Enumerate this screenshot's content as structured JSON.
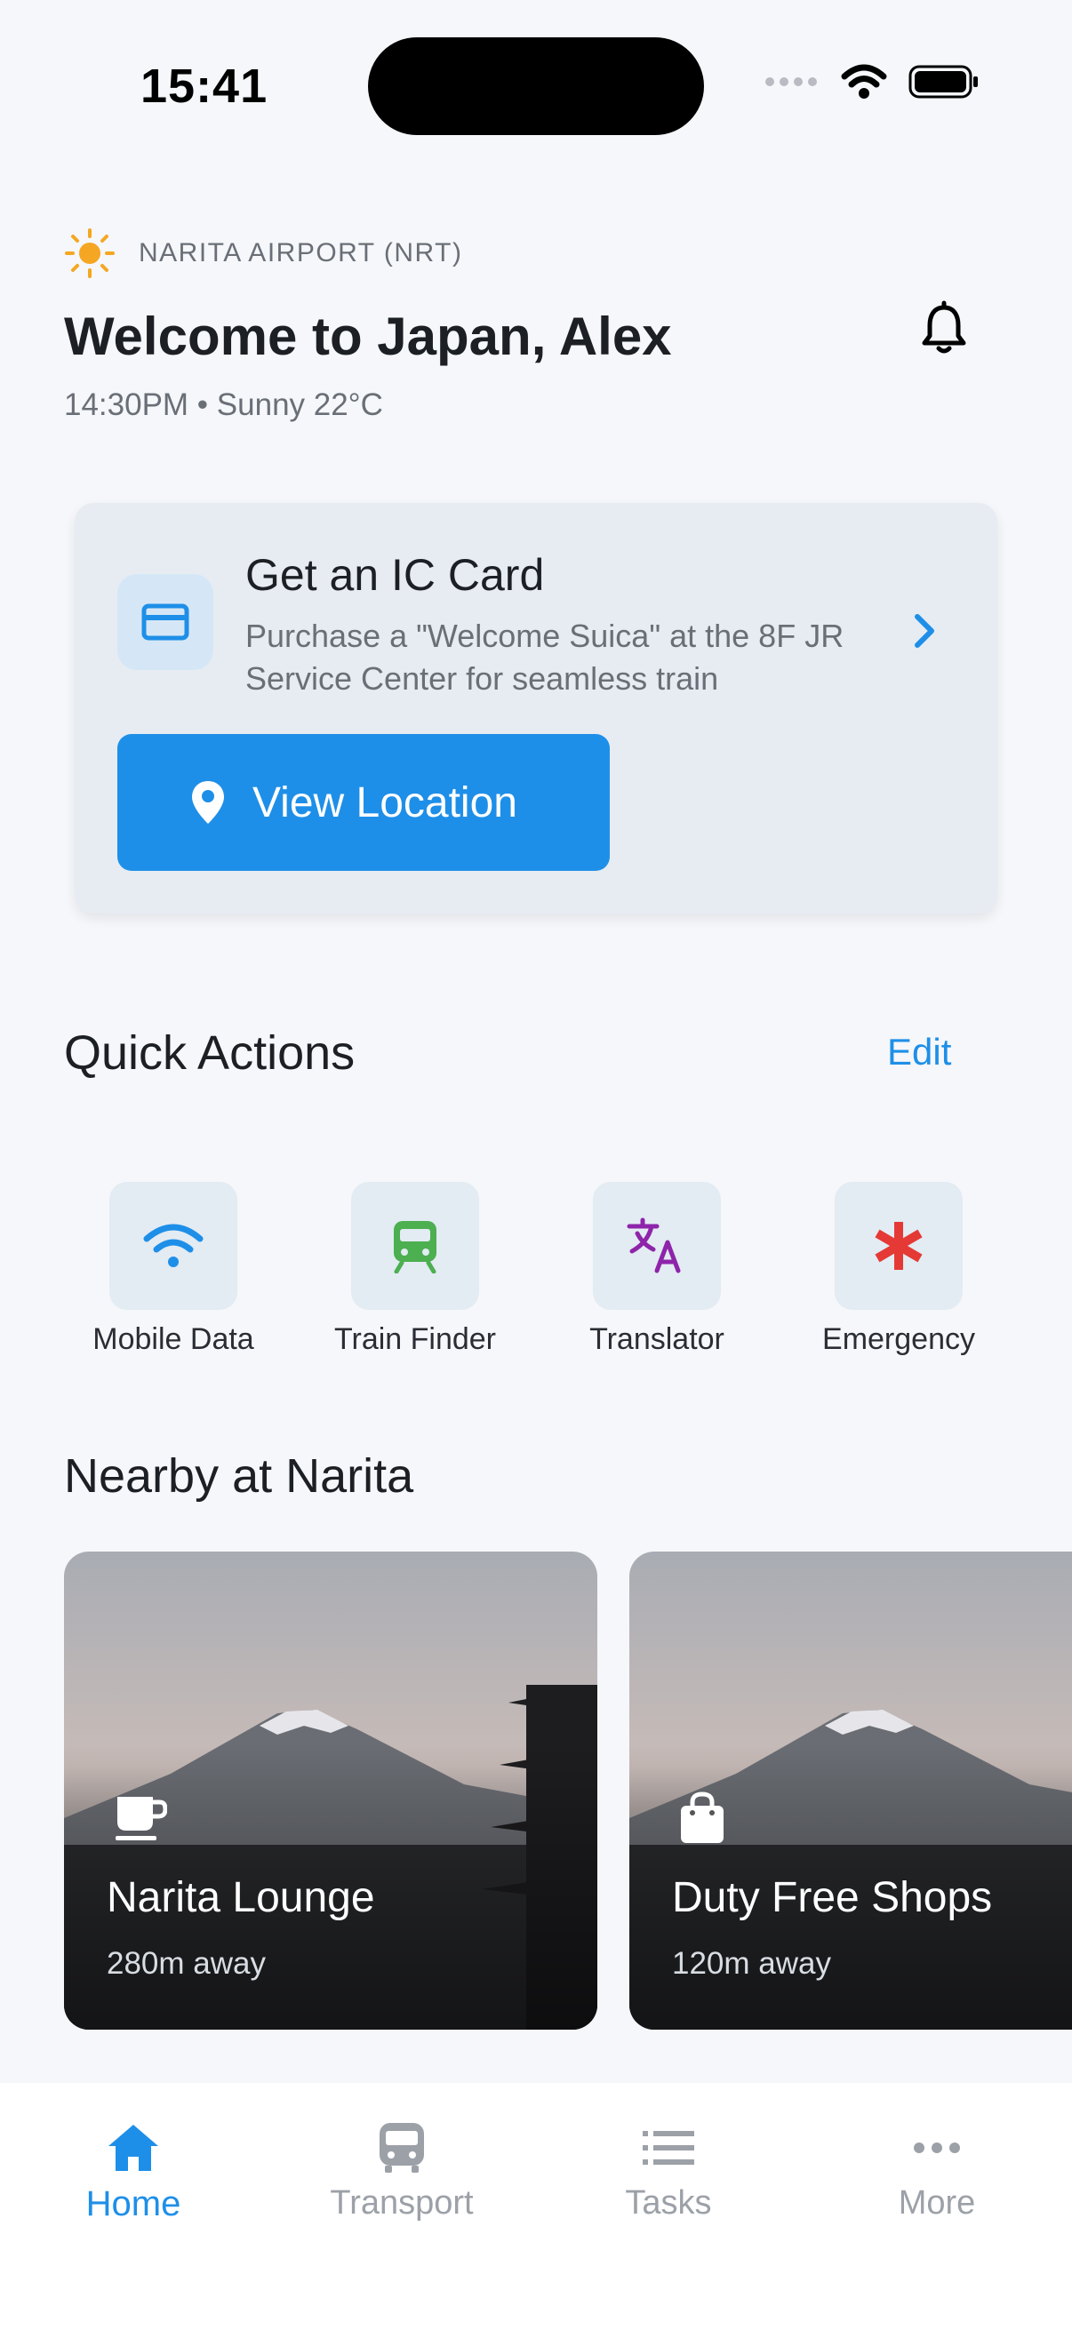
{
  "status_bar": {
    "time": "15:41"
  },
  "header": {
    "location": "NARITA AIRPORT (NRT)",
    "welcome": "Welcome to Japan, Alex",
    "weather": "14:30PM • Sunny 22°C"
  },
  "ic_card": {
    "title": "Get an IC Card",
    "description": "Purchase a \"Welcome Suica\" at the 8F JR Service Center for seamless train",
    "button_label": "View Location"
  },
  "quick_actions": {
    "title": "Quick Actions",
    "edit_label": "Edit",
    "items": [
      {
        "label": "Mobile Data",
        "icon": "wifi-icon",
        "color": "#1e8fe8"
      },
      {
        "label": "Train Finder",
        "icon": "train-icon",
        "color": "#4caf50"
      },
      {
        "label": "Translator",
        "icon": "translate-icon",
        "color": "#8e24aa"
      },
      {
        "label": "Emergency",
        "icon": "asterisk-icon",
        "color": "#e53935"
      }
    ]
  },
  "nearby": {
    "title": "Nearby at Narita",
    "places": [
      {
        "name": "Narita Lounge",
        "distance": "280m away",
        "icon": "coffee-icon"
      },
      {
        "name": "Duty Free Shops",
        "distance": "120m away",
        "icon": "shopping-bag-icon"
      }
    ]
  },
  "tabs": [
    {
      "label": "Home",
      "icon": "home-icon",
      "active": true
    },
    {
      "label": "Transport",
      "icon": "bus-icon",
      "active": false
    },
    {
      "label": "Tasks",
      "icon": "list-icon",
      "active": false
    },
    {
      "label": "More",
      "icon": "more-icon",
      "active": false
    }
  ],
  "colors": {
    "accent": "#1e8fe8",
    "background": "#f5f7fa",
    "card": "#e6ecf2"
  }
}
